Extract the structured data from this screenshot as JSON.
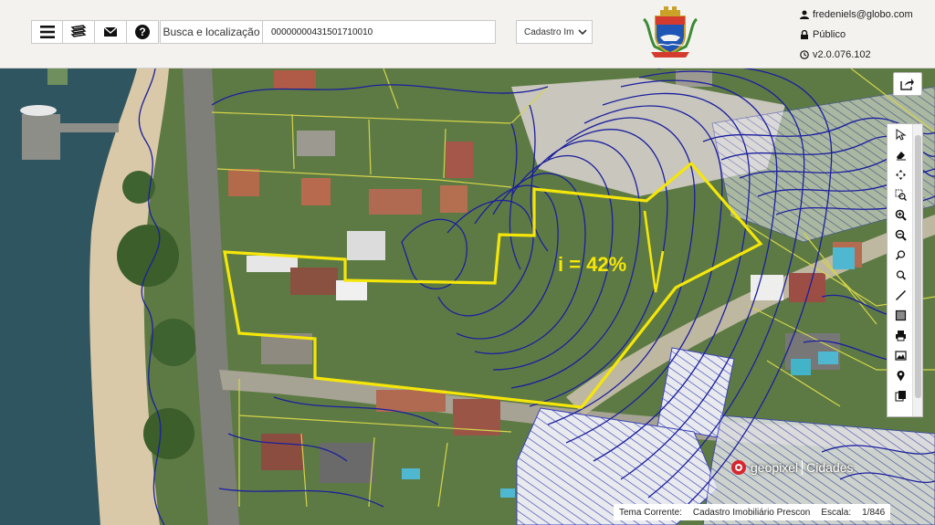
{
  "header": {
    "search_label": "Busca e localização",
    "search_value": "00000000431501710010",
    "layer_select": "Cadastro Im",
    "user_email": "fredeniels@globo.com",
    "access_level": "Público",
    "version": "v2.0.076.102"
  },
  "toolbar_icons": [
    "menu-icon",
    "layers-icon",
    "mail-icon",
    "help-icon"
  ],
  "map": {
    "annotation": "i = 42%",
    "brand_name": "geopixel",
    "brand_product": "Cidades",
    "polygon_color": "#f5e60a",
    "contour_color": "#1b1f9e"
  },
  "map_tools": [
    "cursor-icon",
    "eraser-icon",
    "pan-icon",
    "zoom-box-icon",
    "zoom-in-icon",
    "zoom-out-icon",
    "zoom-previous-icon",
    "zoom-next-icon",
    "measure-line-icon",
    "measure-area-icon",
    "print-icon",
    "image-icon",
    "marker-icon",
    "copy-icon"
  ],
  "status": {
    "theme_label": "Tema Corrente:",
    "theme_value": "Cadastro Imobiliário Prescon",
    "scale_label": "Escala:",
    "scale_value": "1/846"
  }
}
